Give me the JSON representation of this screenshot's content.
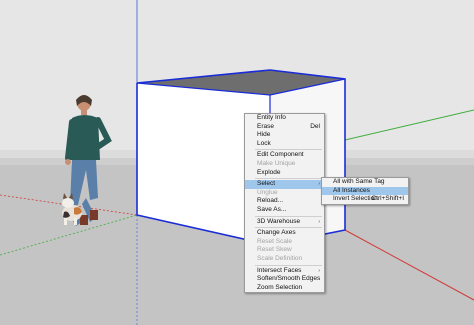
{
  "context_menu": {
    "groups": [
      [
        {
          "label": "Entity Info"
        },
        {
          "label": "Erase",
          "shortcut": "Del"
        },
        {
          "label": "Hide"
        },
        {
          "label": "Lock"
        }
      ],
      [
        {
          "label": "Edit Component"
        },
        {
          "label": "Make Unique",
          "disabled": true
        },
        {
          "label": "Explode"
        }
      ],
      [
        {
          "label": "Select",
          "highlight": true,
          "arrow": "›"
        },
        {
          "label": "Unglue",
          "disabled": true
        },
        {
          "label": "Reload..."
        },
        {
          "label": "Save As..."
        }
      ],
      [
        {
          "label": "3D Warehouse",
          "arrow": "›"
        }
      ],
      [
        {
          "label": "Change Axes"
        },
        {
          "label": "Reset Scale",
          "disabled": true
        },
        {
          "label": "Reset Skew",
          "disabled": true
        },
        {
          "label": "Scale Definition",
          "disabled": true
        }
      ],
      [
        {
          "label": "Intersect Faces",
          "arrow": "›"
        },
        {
          "label": "Soften/Smooth Edges"
        },
        {
          "label": "Zoom Selection"
        }
      ]
    ]
  },
  "submenu": {
    "items": [
      {
        "label": "All with Same Tag"
      },
      {
        "label": "All Instances",
        "highlight": true
      },
      {
        "label": "Invert Selection",
        "shortcut": "Ctrl+Shift+I"
      }
    ]
  },
  "colors": {
    "sky": "#e6e6e6",
    "ground": "#c4c4c4",
    "box_top": "#6e6e6e",
    "selection_edge": "#1a2bd8",
    "axis_red": "#d23a3a",
    "axis_green": "#3fae3f",
    "axis_blue": "#5a72e6",
    "menu_highlight": "#9fc7ec"
  },
  "figures": [
    "person-figure",
    "cat-figure"
  ]
}
